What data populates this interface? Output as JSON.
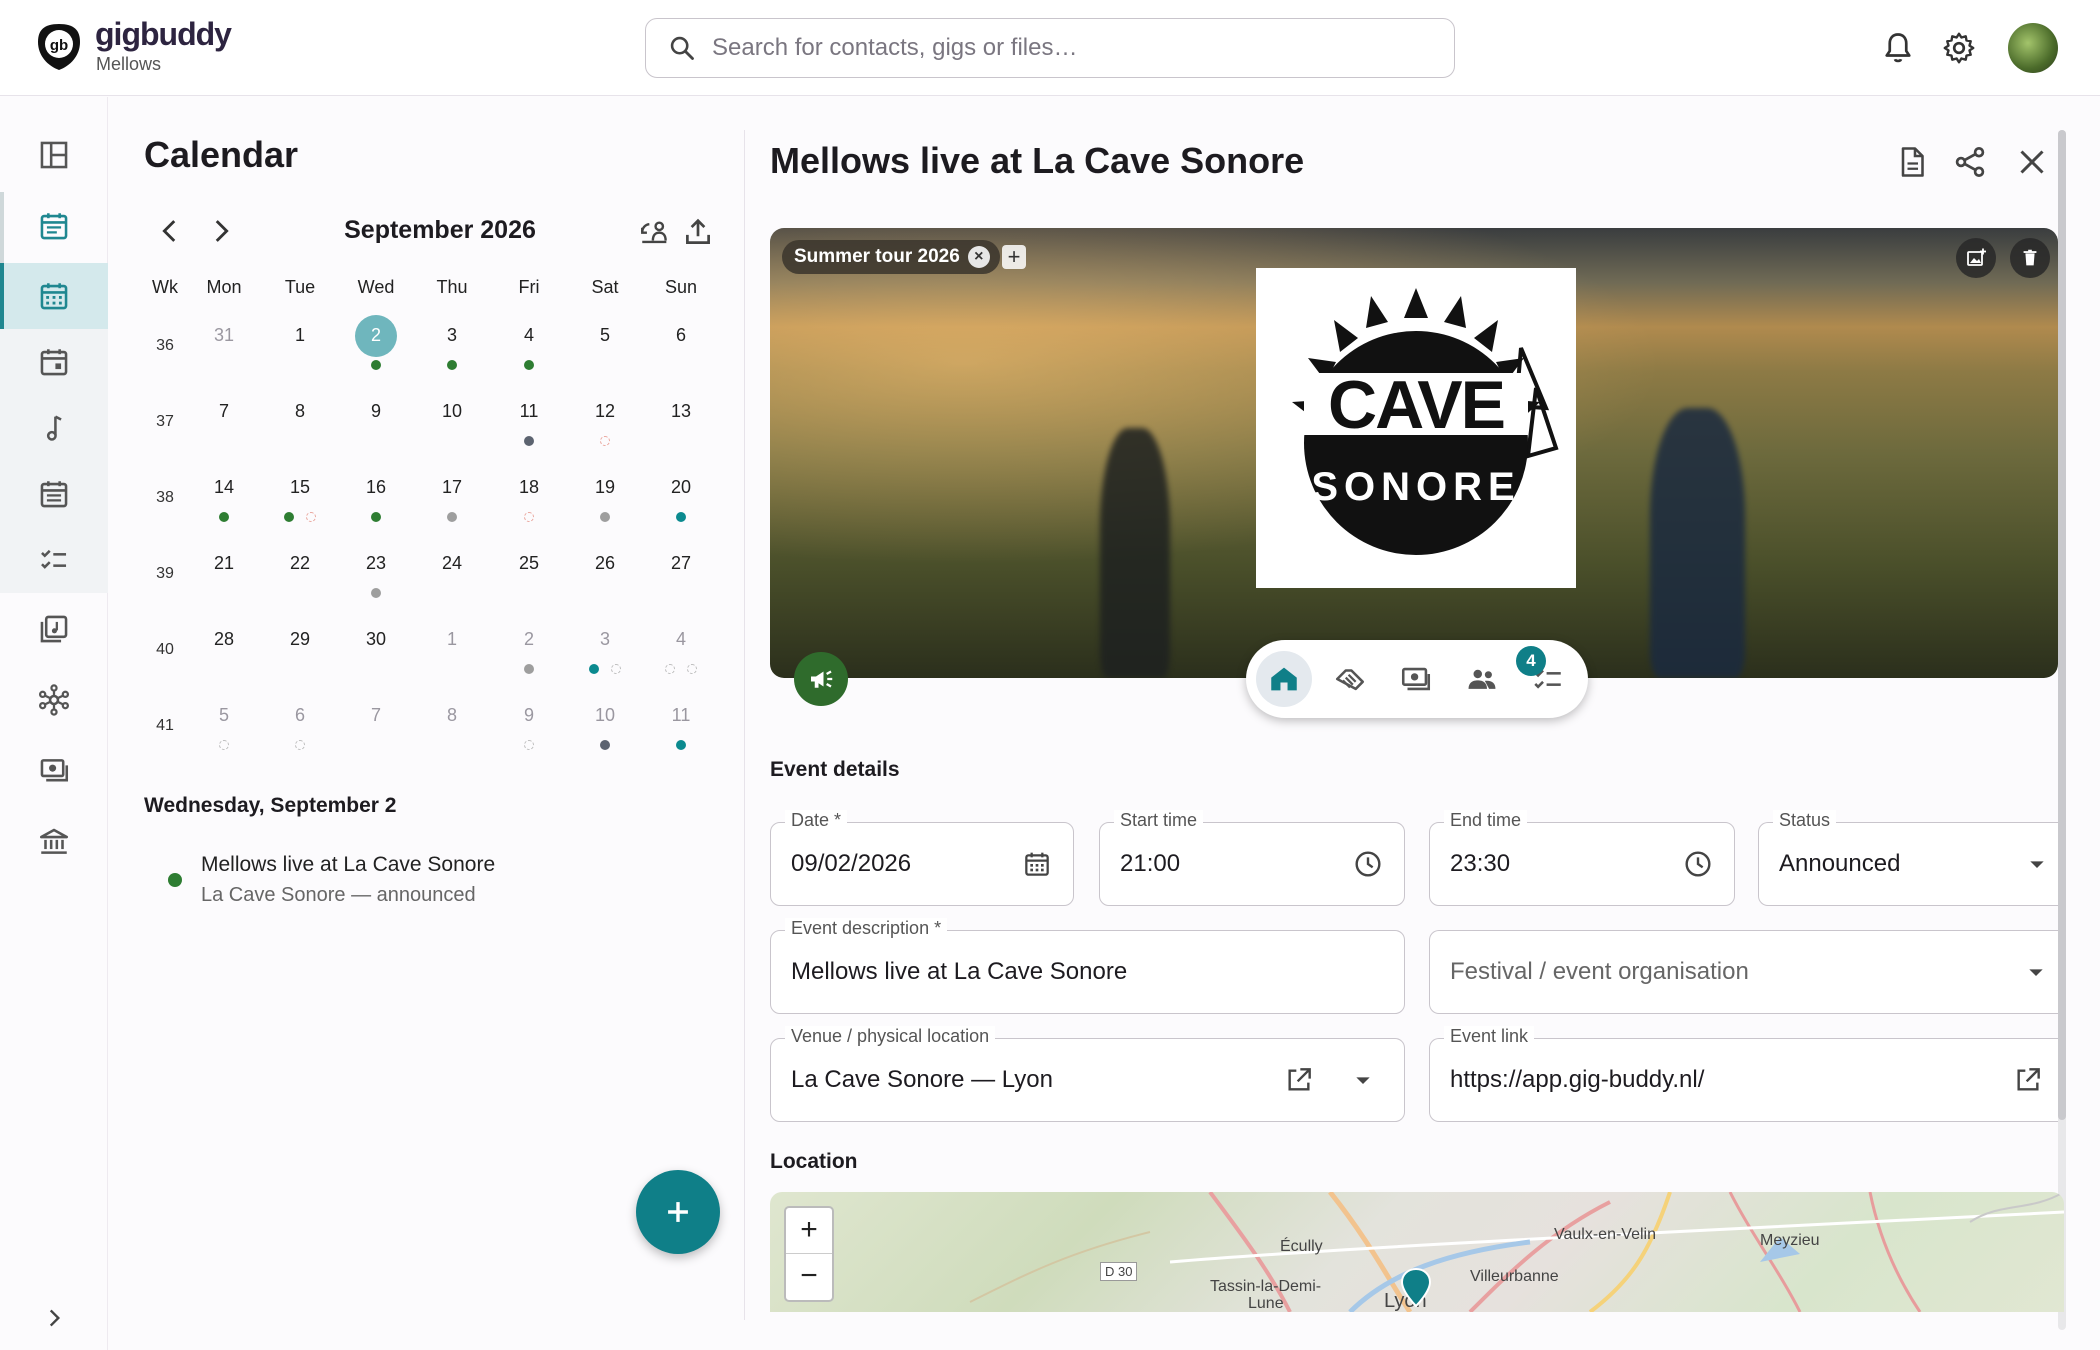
{
  "brand": {
    "name": "gigbuddy",
    "workspace": "Mellows",
    "mark": "gb"
  },
  "search": {
    "placeholder": "Search for contacts, gigs or files…"
  },
  "calendar": {
    "title": "Calendar",
    "month": "September 2026",
    "headers": [
      "Wk",
      "Mon",
      "Tue",
      "Wed",
      "Thu",
      "Fri",
      "Sat",
      "Sun"
    ],
    "weeks": [
      {
        "wk": "36",
        "days": [
          "31",
          "1",
          "2",
          "3",
          "4",
          "5",
          "6"
        ]
      },
      {
        "wk": "37",
        "days": [
          "7",
          "8",
          "9",
          "10",
          "11",
          "12",
          "13"
        ]
      },
      {
        "wk": "38",
        "days": [
          "14",
          "15",
          "16",
          "17",
          "18",
          "19",
          "20"
        ]
      },
      {
        "wk": "39",
        "days": [
          "21",
          "22",
          "23",
          "24",
          "25",
          "26",
          "27"
        ]
      },
      {
        "wk": "40",
        "days": [
          "28",
          "29",
          "30",
          "1",
          "2",
          "3",
          "4"
        ]
      },
      {
        "wk": "41",
        "days": [
          "5",
          "6",
          "7",
          "8",
          "9",
          "10",
          "11"
        ]
      }
    ],
    "selected_day_title": "Wednesday, September 2",
    "events": [
      {
        "title": "Mellows live at La Cave Sonore",
        "subtitle": "La Cave Sonore — announced"
      }
    ]
  },
  "detail": {
    "title": "Mellows live at La Cave Sonore",
    "tag": "Summer tour 2026",
    "tag_add": "+",
    "venue_logo": {
      "line1": "CAVE",
      "line2": "SONORE"
    },
    "tasks_badge": "4",
    "section_event_details": "Event details",
    "fields": {
      "date": {
        "label": "Date *",
        "value": "09/02/2026"
      },
      "start": {
        "label": "Start time",
        "value": "21:00"
      },
      "end": {
        "label": "End time",
        "value": "23:30"
      },
      "status": {
        "label": "Status",
        "value": "Announced"
      },
      "description": {
        "label": "Event description *",
        "value": "Mellows live at La Cave Sonore"
      },
      "organisation": {
        "placeholder": "Festival / event organisation"
      },
      "venue": {
        "label": "Venue / physical location",
        "value": "La Cave Sonore — Lyon"
      },
      "link": {
        "label": "Event link",
        "value": "https://app.gig-buddy.nl/"
      }
    },
    "section_location": "Location",
    "map": {
      "zoom_in": "+",
      "zoom_out": "−",
      "labels": [
        "Vaulx-en-Velin",
        "Meyzieu",
        "Écully",
        "Villeurbanne",
        "D 30",
        "Tassin-la-Demi-",
        "Lune",
        "Lyon"
      ]
    }
  }
}
